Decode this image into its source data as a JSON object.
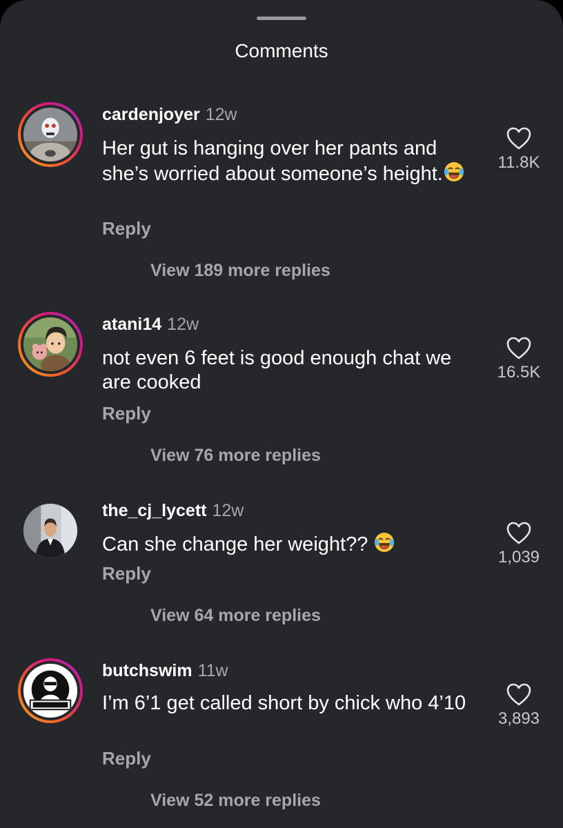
{
  "header": {
    "title": "Comments"
  },
  "comments": [
    {
      "username": "cardenjoyer",
      "time": "12w",
      "text": "Her gut is hanging over her pants and she’s worried about someone’s height.",
      "reply_label": "Reply",
      "view_replies": "View 189 more replies",
      "likes": "11.8K",
      "avatar_icon": "skull-mask-avatar"
    },
    {
      "username": "atani14",
      "time": "12w",
      "text": "not even 6 feet is good enough chat we are cooked",
      "reply_label": "Reply",
      "view_replies": "View 76 more replies",
      "likes": "16.5K",
      "avatar_icon": "anime-boy-avatar"
    },
    {
      "username": "the_cj_lycett",
      "time": "12w",
      "text": "Can she change her weight??",
      "reply_label": "Reply",
      "view_replies": "View 64 more replies",
      "likes": "1,039",
      "avatar_icon": "suited-man-avatar"
    },
    {
      "username": "butchswim",
      "time": "11w",
      "text": "I’m 6’1 get called short by chick who 4’10",
      "reply_label": "Reply",
      "view_replies": "View 52 more replies",
      "likes": "3,893",
      "avatar_icon": "butch-swim-logo-avatar"
    }
  ],
  "colors": {
    "sheet_bg": "#26272b",
    "secondary_text": "#a6a7ab",
    "story_ring": [
      "#f9a826",
      "#d3197e",
      "#a12fc0"
    ]
  }
}
